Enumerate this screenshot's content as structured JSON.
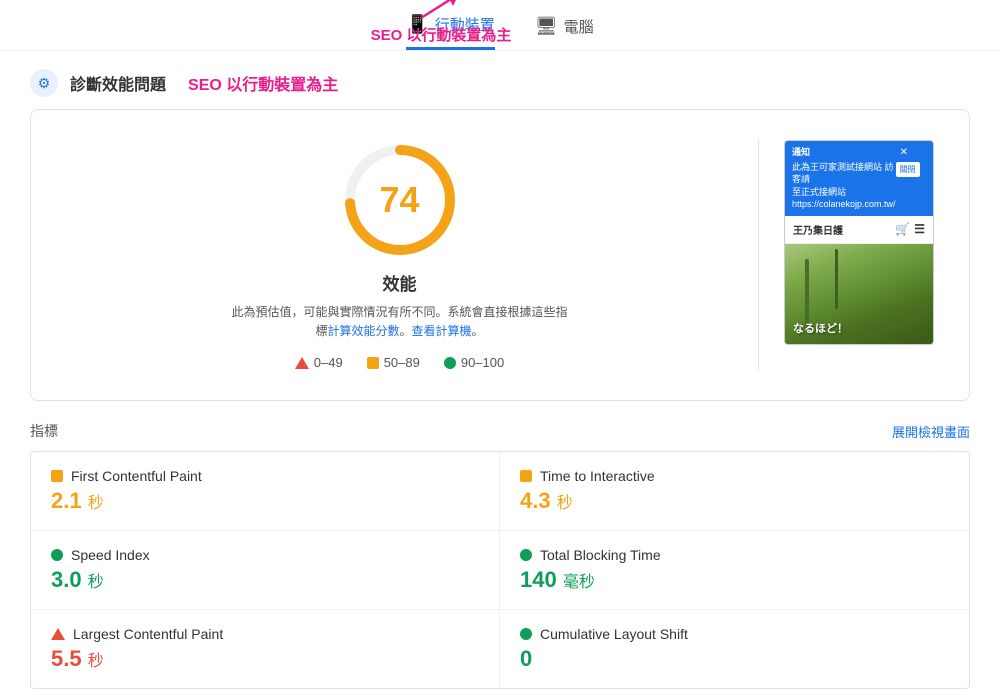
{
  "nav": {
    "mobile_icon": "📱",
    "mobile_label": "行動裝置",
    "desktop_icon": "💻",
    "desktop_label": "電腦",
    "active": "mobile"
  },
  "annotation": {
    "text": "SEO 以行動裝置為主"
  },
  "diagnostic": {
    "title": "診斷效能問題",
    "subtitle": "SEO 以行動裝置為主"
  },
  "score": {
    "value": "74",
    "label": "效能",
    "description": "此為預估值，可能與實際情況有所不同。系統會直接根據這些指標",
    "link1": "計算效能分數",
    "description2": "。",
    "link2": "查看計算機",
    "legend_0_49": "0–49",
    "legend_50_89": "50–89",
    "legend_90_100": "90–100"
  },
  "mockup": {
    "notification_text": "通知\n此為王可家測試接網站 訪客請\n至正式接網站\nhttps://colanekojp.com.tw/",
    "notification_btn": "關閉",
    "header_text": "王乃集日護",
    "image_text": "なるほど！"
  },
  "metrics": {
    "header_label": "指標",
    "expand_label": "展開檢視畫面",
    "items": [
      {
        "name": "First Contentful Paint",
        "value": "2.1",
        "unit": "秒",
        "color": "orange",
        "indicator": "square"
      },
      {
        "name": "Time to Interactive",
        "value": "4.3",
        "unit": "秒",
        "color": "orange",
        "indicator": "square"
      },
      {
        "name": "Speed Index",
        "value": "3.0",
        "unit": "秒",
        "color": "green",
        "indicator": "circle"
      },
      {
        "name": "Total Blocking Time",
        "value": "140",
        "unit": "毫秒",
        "color": "green",
        "indicator": "circle"
      },
      {
        "name": "Largest Contentful Paint",
        "value": "5.5",
        "unit": "秒",
        "color": "red",
        "indicator": "triangle"
      },
      {
        "name": "Cumulative Layout Shift",
        "value": "0",
        "unit": "",
        "color": "green",
        "indicator": "circle"
      }
    ]
  }
}
